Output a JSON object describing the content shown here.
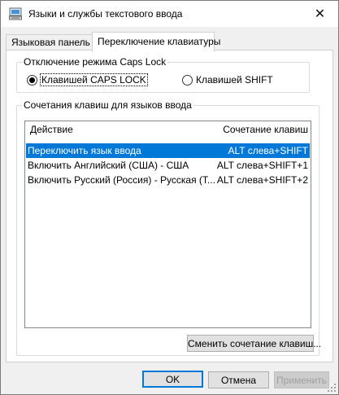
{
  "window": {
    "title": "Языки и службы текстового ввода",
    "close_glyph": "✕"
  },
  "tabs": [
    {
      "label": "Языковая панель"
    },
    {
      "label": "Переключение клавиатуры"
    }
  ],
  "caps_lock": {
    "group_label": "Отключение режима Caps Lock",
    "option_caps": "Клавишей CAPS LOCK",
    "option_shift": "Клавишей SHIFT",
    "selected": "caps"
  },
  "hotkeys": {
    "group_label": "Сочетания клавиш для языков ввода",
    "columns": [
      "Действие",
      "Сочетание клавиш"
    ],
    "rows": [
      {
        "action": "Переключить язык ввода",
        "keys": "ALT слева+SHIFT"
      },
      {
        "action": "Включить Английский (США) - США",
        "keys": "ALT слева+SHIFT+1"
      },
      {
        "action": "Включить Русский (Россия) - Русская (Т...",
        "keys": "ALT слева+SHIFT+2"
      }
    ],
    "selected_row": 0,
    "change_button": "Сменить сочетание клавиш..."
  },
  "buttons": {
    "ok": "OK",
    "cancel": "Отмена",
    "apply": "Применить"
  },
  "icons": {
    "title": "keyboard-icon",
    "close": "close-icon"
  },
  "colors": {
    "selection": "#0078d7",
    "window_bg": "#f0f0f0"
  }
}
